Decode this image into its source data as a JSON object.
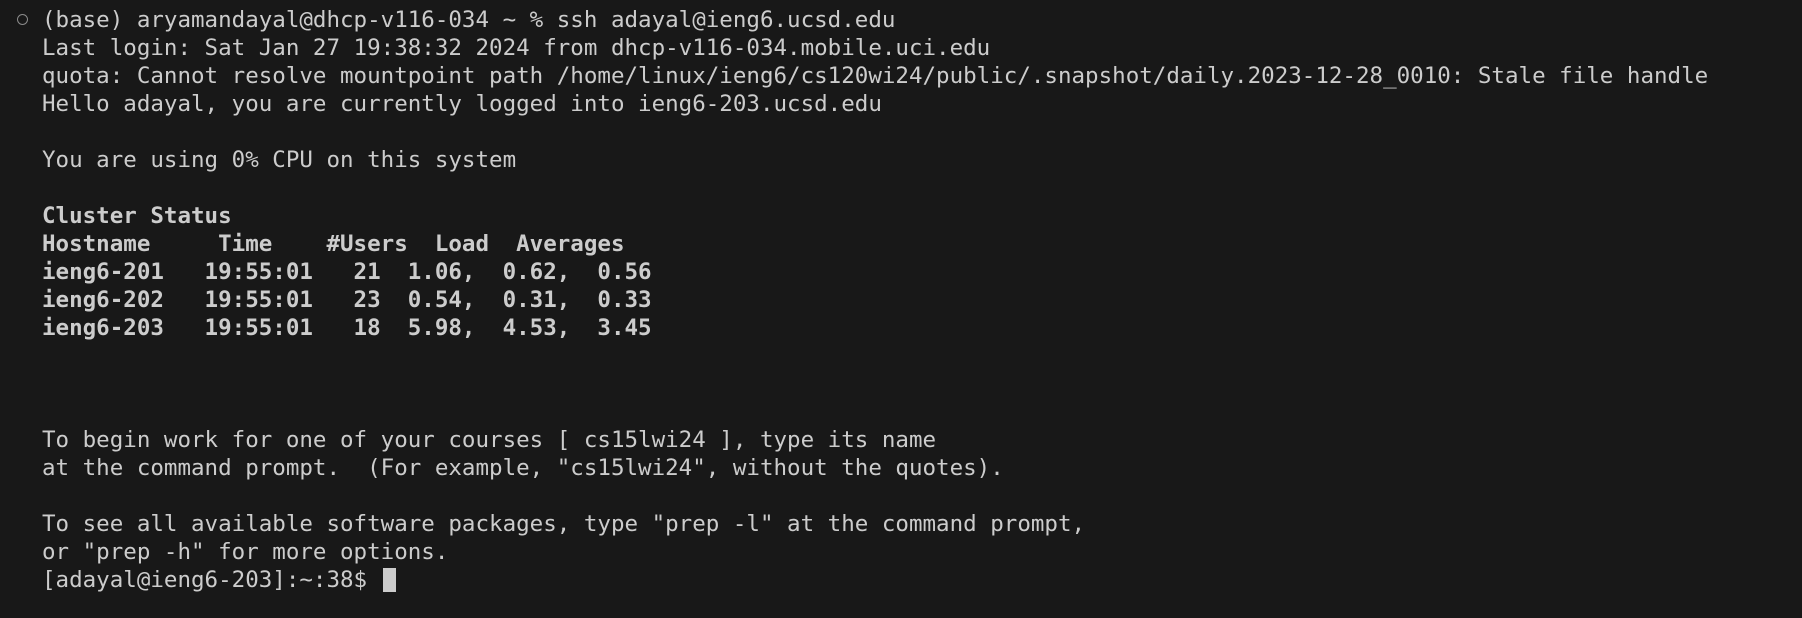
{
  "terminal": {
    "prompt_line": "(base) aryamandayal@dhcp-v116-034 ~ % ssh adayal@ieng6.ucsd.edu",
    "last_login": "Last login: Sat Jan 27 19:38:32 2024 from dhcp-v116-034.mobile.uci.edu",
    "quota_error": "quota: Cannot resolve mountpoint path /home/linux/ieng6/cs120wi24/public/.snapshot/daily.2023-12-28_0010: Stale file handle",
    "hello": "Hello adayal, you are currently logged into ieng6-203.ucsd.edu",
    "cpu_usage": "You are using 0% CPU on this system",
    "cluster_status_title": "Cluster Status",
    "cluster_header": "Hostname     Time    #Users  Load  Averages",
    "cluster_rows": [
      "ieng6-201   19:55:01   21  1.06,  0.62,  0.56",
      "ieng6-202   19:55:01   23  0.54,  0.31,  0.33",
      "ieng6-203   19:55:01   18  5.98,  4.53,  3.45"
    ],
    "courses_line1": "To begin work for one of your courses [ cs15lwi24 ], type its name",
    "courses_line2": "at the command prompt.  (For example, \"cs15lwi24\", without the quotes).",
    "prep_line1": "To see all available software packages, type \"prep -l\" at the command prompt,",
    "prep_line2": "or \"prep -h\" for more options.",
    "remote_prompt": "[adayal@ieng6-203]:~:38$ "
  },
  "colors": {
    "background": "#181818",
    "foreground": "#cccccc"
  }
}
